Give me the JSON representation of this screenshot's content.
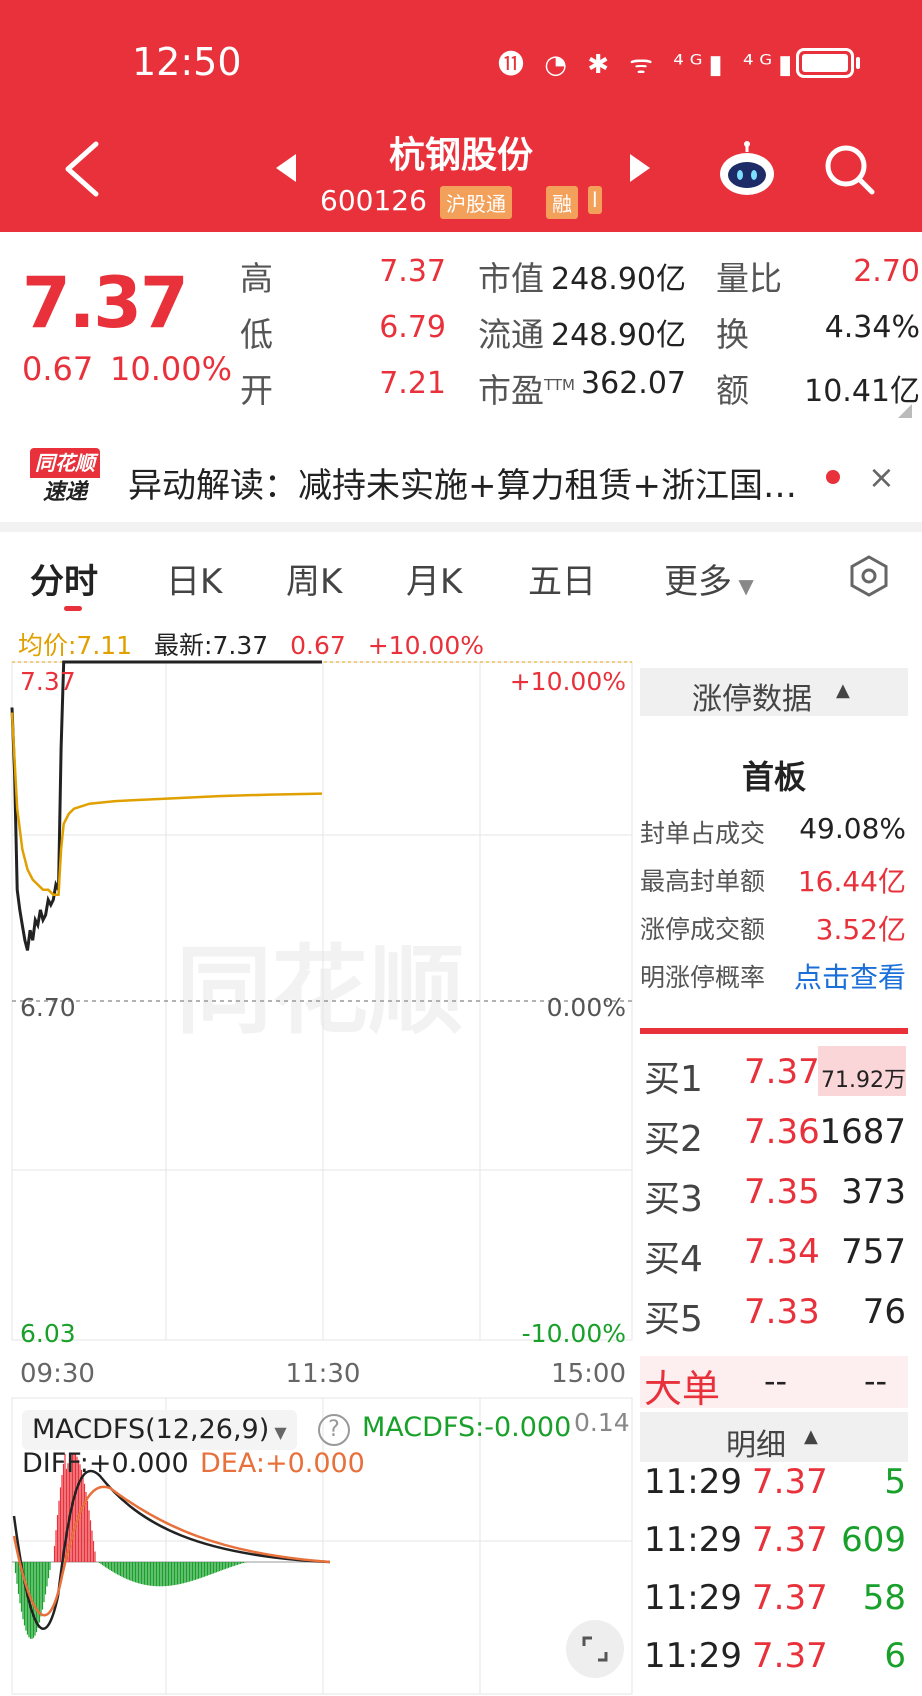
{
  "status_bar": {
    "time": "12:50",
    "icons": "⓫ ◔ ✱ ᯤ ⁴ᴳ▮ ⁴ᴳ▮"
  },
  "header": {
    "stock_name": "杭钢股份",
    "stock_code": "600126",
    "tags": [
      "沪股通",
      "融",
      "l"
    ]
  },
  "quote": {
    "price": "7.37",
    "change": "0.67",
    "change_pct": "10.00%",
    "fields": [
      {
        "label": "高",
        "value": "7.37"
      },
      {
        "label": "低",
        "value": "6.79"
      },
      {
        "label": "开",
        "value": "7.21"
      },
      {
        "label": "市值",
        "value": "248.90亿"
      },
      {
        "label": "流通",
        "value": "248.90亿"
      },
      {
        "label": "市盈",
        "label_sup": "TTM",
        "value": "362.07"
      },
      {
        "label": "量比",
        "value": "2.70"
      },
      {
        "label": "换",
        "value": "4.34%"
      },
      {
        "label": "额",
        "value": "10.41亿"
      }
    ]
  },
  "news": {
    "logo_top": "同花顺",
    "logo_bottom": "速递",
    "text": "异动解读：减持未实施+算力租赁+浙江国…",
    "close": "×"
  },
  "tabs": [
    "分时",
    "日K",
    "周K",
    "月K",
    "五日",
    "更多"
  ],
  "chart_info": {
    "avg_label": "均价:7.11",
    "latest_label": "最新:7.37",
    "change": "0.67",
    "change_pct": "+10.00%"
  },
  "chart_data": {
    "type": "line",
    "axis": {
      "y_left": [
        "7.37",
        "6.70",
        "6.03"
      ],
      "y_right": [
        "+10.00%",
        "0.00%",
        "-10.00%"
      ],
      "x": [
        "09:30",
        "11:30",
        "15:00"
      ],
      "ylim": [
        6.03,
        7.37
      ]
    },
    "watermark": "同花顺",
    "series": [
      {
        "role": "price",
        "color": "#222222",
        "x": [
          0,
          1,
          2,
          3,
          4,
          5,
          6,
          7,
          8,
          9,
          10,
          11,
          12,
          13,
          14,
          15,
          16,
          17,
          18,
          19,
          20,
          21,
          22,
          23,
          24,
          120
        ],
        "values": [
          7.28,
          7.15,
          6.92,
          6.88,
          6.85,
          6.82,
          6.8,
          6.84,
          6.82,
          6.86,
          6.85,
          6.88,
          6.86,
          6.87,
          6.9,
          6.89,
          6.9,
          6.93,
          6.92,
          7.2,
          7.37,
          7.37,
          7.37,
          7.37,
          7.37,
          7.37
        ]
      },
      {
        "role": "average",
        "color": "#e0a000",
        "x": [
          0,
          2,
          4,
          6,
          8,
          10,
          12,
          14,
          16,
          18,
          19,
          20,
          22,
          24,
          30,
          40,
          60,
          80,
          100,
          120
        ],
        "values": [
          7.27,
          7.08,
          7.0,
          6.96,
          6.94,
          6.93,
          6.92,
          6.92,
          6.91,
          6.91,
          7.0,
          7.05,
          7.07,
          7.08,
          7.09,
          7.095,
          7.1,
          7.105,
          7.108,
          7.11
        ]
      }
    ]
  },
  "macd": {
    "selector": "MACDFS(12,26,9)",
    "help": "?",
    "value_label": "MACDFS:-0.000",
    "top_value": "0.14",
    "diff_label": "DIFF:+0.000",
    "dea_label": "DEA:+0.000"
  },
  "panel": {
    "limit_title": "涨停数据",
    "board": "首板",
    "stats": [
      {
        "label": "封单占成交",
        "value": "49.08%",
        "color": "#222222"
      },
      {
        "label": "最高封单额",
        "value": "16.44亿",
        "color": "#e8313a"
      },
      {
        "label": "涨停成交额",
        "value": "3.52亿",
        "color": "#e8313a"
      },
      {
        "label": "明涨停概率",
        "value": "点击查看",
        "color": "#1a6fd8"
      }
    ],
    "orderbook": [
      {
        "label": "买1",
        "price": "7.37",
        "vol": "71.92万"
      },
      {
        "label": "买2",
        "price": "7.36",
        "vol": "1687"
      },
      {
        "label": "买3",
        "price": "7.35",
        "vol": "373"
      },
      {
        "label": "买4",
        "price": "7.34",
        "vol": "757"
      },
      {
        "label": "买5",
        "price": "7.33",
        "vol": "76"
      }
    ],
    "big_order": {
      "label": "大单",
      "v1": "--",
      "v2": "--"
    },
    "detail_title": "明细",
    "details": [
      {
        "time": "11:29",
        "price": "7.37",
        "vol": "5"
      },
      {
        "time": "11:29",
        "price": "7.37",
        "vol": "609"
      },
      {
        "time": "11:29",
        "price": "7.37",
        "vol": "58"
      },
      {
        "time": "11:29",
        "price": "7.37",
        "vol": "6"
      }
    ]
  }
}
